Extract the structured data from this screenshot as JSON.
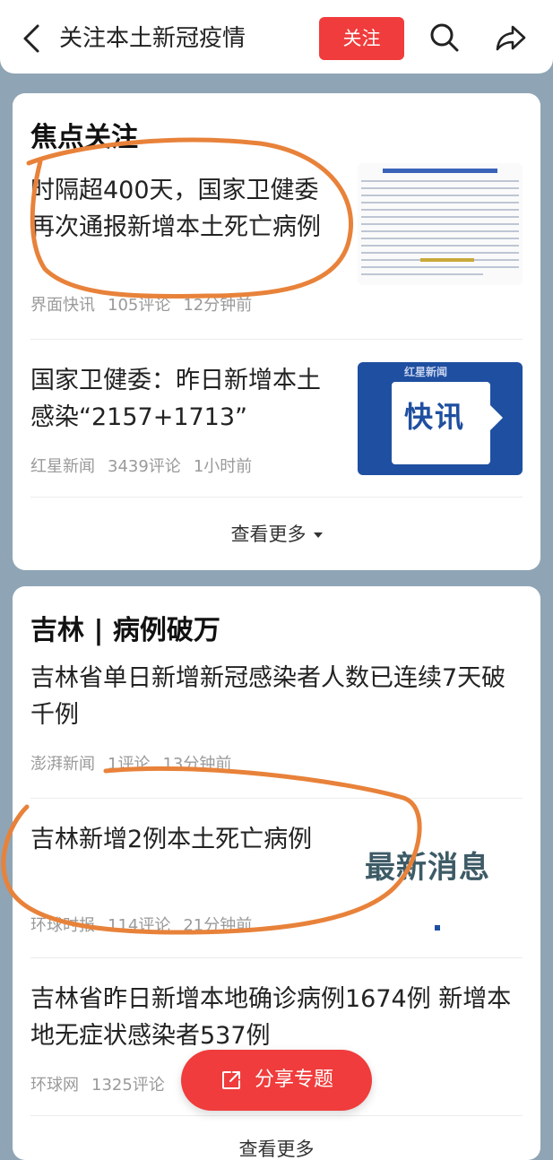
{
  "header": {
    "title": "关注本土新冠疫情",
    "follow_label": "关注",
    "icons": [
      "back-arrow-icon",
      "search-icon",
      "share-icon"
    ]
  },
  "focus": {
    "title": "焦点关注",
    "items": [
      {
        "title": "时隔超400天，国家卫健委再次通报新增本土死亡病例",
        "source": "界面快讯",
        "comments": "105评论",
        "time": "12分钟前"
      },
      {
        "title": "国家卫健委：昨日新增本土感染“2157+1713”",
        "source": "红星新闻",
        "comments": "3439评论",
        "time": "1小时前",
        "thumb_text": "快讯",
        "thumb_brand": "红星新闻"
      }
    ],
    "more_label": "查看更多"
  },
  "jilin": {
    "title": "吉林 | 病例破万",
    "items": [
      {
        "title": "吉林省单日新增新冠感染者人数已连续7天破千例",
        "source": "澎湃新闻",
        "comments": "1评论",
        "time": "13分钟前"
      },
      {
        "title": "吉林新增2例本土死亡病例",
        "source": "环球时报",
        "comments": "114评论",
        "time": "21分钟前",
        "thumb_text": "最新消息"
      },
      {
        "title": "吉林省昨日新增本地确诊病例1674例 新增本地无症状感染者537例",
        "source": "环球网",
        "comments": "1325评论",
        "time": ""
      }
    ],
    "more_label": "查看更多"
  },
  "share_button": {
    "label": "分享专题"
  },
  "colors": {
    "accent": "#f03c3c",
    "background": "#8fa5b5",
    "annotation": "#e8823a",
    "thumb_blue": "#1f4fa0"
  }
}
